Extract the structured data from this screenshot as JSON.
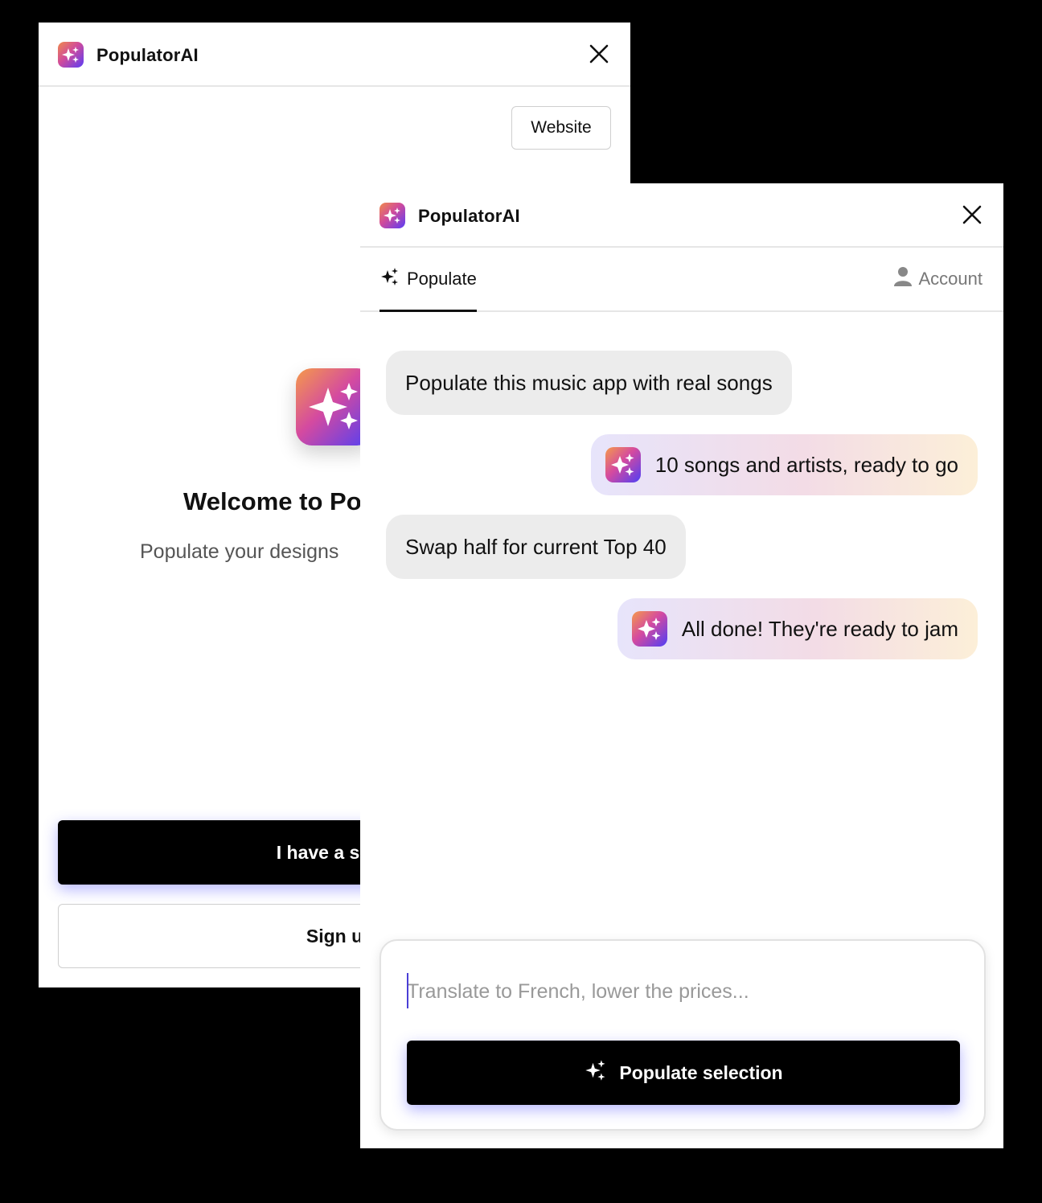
{
  "colors": {
    "accent_shadow": "#5a5aff",
    "background": "#000000"
  },
  "back_window": {
    "app_name": "PopulatorAI",
    "website_label": "Website",
    "welcome_title": "Welcome to Po",
    "subtitle": "Populate your designs ",
    "subscription_label": "I have a subs",
    "signup_label": "Sign u"
  },
  "front_window": {
    "app_name": "PopulatorAI",
    "tabs": {
      "populate": "Populate",
      "account": "Account"
    },
    "messages": [
      {
        "role": "user",
        "text": "Populate this music app with real songs"
      },
      {
        "role": "ai",
        "text": "10 songs and artists, ready to go"
      },
      {
        "role": "user",
        "text": "Swap half for current Top 40"
      },
      {
        "role": "ai",
        "text": "All done! They're ready to jam"
      }
    ],
    "input": {
      "value": "",
      "placeholder": "Translate to French, lower the prices..."
    },
    "populate_button": "Populate selection"
  }
}
